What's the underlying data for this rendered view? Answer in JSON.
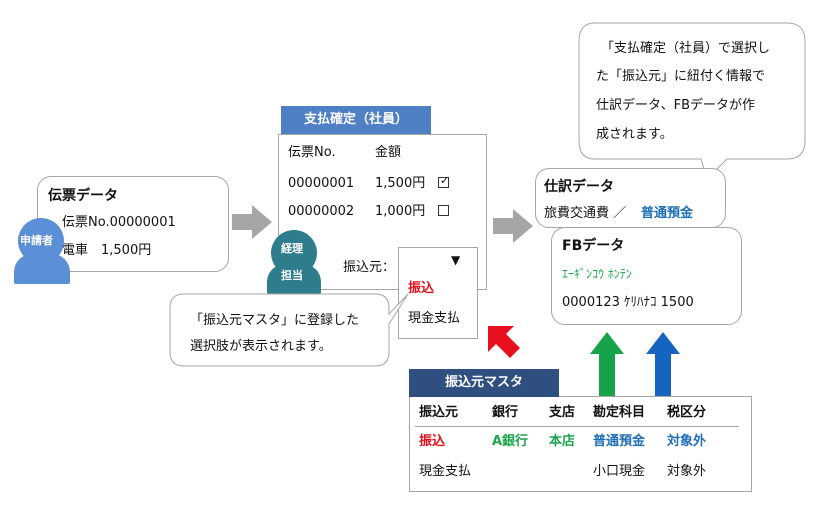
{
  "applicant_card": {
    "title": "伝票データ",
    "line1": "伝票No.00000001",
    "line2": "電車　1,500円"
  },
  "applicant_avatar": {
    "label": "申請者",
    "color": "#5b8fd6"
  },
  "payment_confirm": {
    "header": "支払確定（社員）",
    "col1": "伝票No.",
    "col2": "金額",
    "rows": [
      {
        "no": "00000001",
        "amount": "1,500円",
        "checked": true
      },
      {
        "no": "00000002",
        "amount": "1,000円",
        "checked": false
      }
    ],
    "source_label": "振込元：",
    "header_color": "#4f7fc4"
  },
  "accounting_avatar": {
    "label_line1": "経理",
    "label_line2": "担当",
    "color": "#2e7d8c"
  },
  "dropdown": {
    "options": [
      "振込",
      "現金支払"
    ],
    "selected_color": "#e0101a"
  },
  "callout_left": {
    "line1": "「振込元マスタ」に登録した",
    "line2": "選択肢が表示されます。"
  },
  "callout_top": {
    "line1": "「支払確定（社員）で選択し",
    "line2": "た「振込元」に紐付く情報で",
    "line3": "仕訳データ、FBデータが作",
    "line4": "成されます。"
  },
  "journal_card": {
    "title": "仕訳データ",
    "line_prefix": "旅費交通費 ／ ",
    "line_highlight": "普通預金"
  },
  "fb_card": {
    "title": "FBデータ",
    "line1": "ｴｰｷﾞﾝｺｳ ﾎﾝﾃﾝ",
    "line2": "0000123 ｹﾘﾊﾅｺ 1500"
  },
  "master_table": {
    "header": "振込元マスタ",
    "header_color": "#2e4f7f",
    "columns": [
      "振込元",
      "銀行",
      "支店",
      "勘定科目",
      "税区分"
    ],
    "rows": [
      [
        "振込",
        "A銀行",
        "本店",
        "普通預金",
        "対象外"
      ],
      [
        "現金支払",
        "",
        "",
        "小口現金",
        "対象外"
      ]
    ]
  },
  "colors": {
    "arrow_gray": "#a6a6a6",
    "arrow_red": "#e8101e",
    "arrow_green": "#16a34a",
    "arrow_blue": "#1565c0",
    "accent_blue": "#1f6fb8",
    "accent_red": "#e0101a",
    "accent_green": "#1aa54a"
  }
}
